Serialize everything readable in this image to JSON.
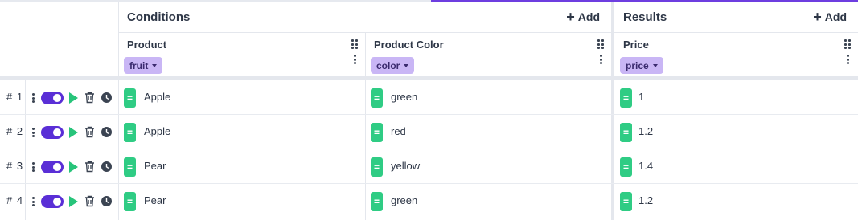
{
  "groups": {
    "conditions": {
      "title": "Conditions",
      "add_label": "Add"
    },
    "results": {
      "title": "Results",
      "add_label": "Add"
    }
  },
  "columns": {
    "product": {
      "title": "Product",
      "tag": "fruit"
    },
    "product_color": {
      "title": "Product Color",
      "tag": "color"
    },
    "price": {
      "title": "Price",
      "tag": "price"
    }
  },
  "operator_label": "=",
  "rows": [
    {
      "num": "# 1",
      "product": "Apple",
      "color": "green",
      "price": "1",
      "enabled": true
    },
    {
      "num": "# 2",
      "product": "Apple",
      "color": "red",
      "price": "1.2",
      "enabled": true
    },
    {
      "num": "# 3",
      "product": "Pear",
      "color": "yellow",
      "price": "1.4",
      "enabled": true
    },
    {
      "num": "# 4",
      "product": "Pear",
      "color": "green",
      "price": "1.2",
      "enabled": true
    }
  ],
  "colors": {
    "accent": "#5a2fd6",
    "tag_bg": "#c9b6f5",
    "operator_green": "#2fcc84",
    "run_green": "#27c47a"
  },
  "icons": [
    "drag-handle-icon",
    "kebab-menu-icon",
    "play-icon",
    "trash-icon",
    "clock-icon",
    "plus-icon",
    "caret-down-icon"
  ]
}
